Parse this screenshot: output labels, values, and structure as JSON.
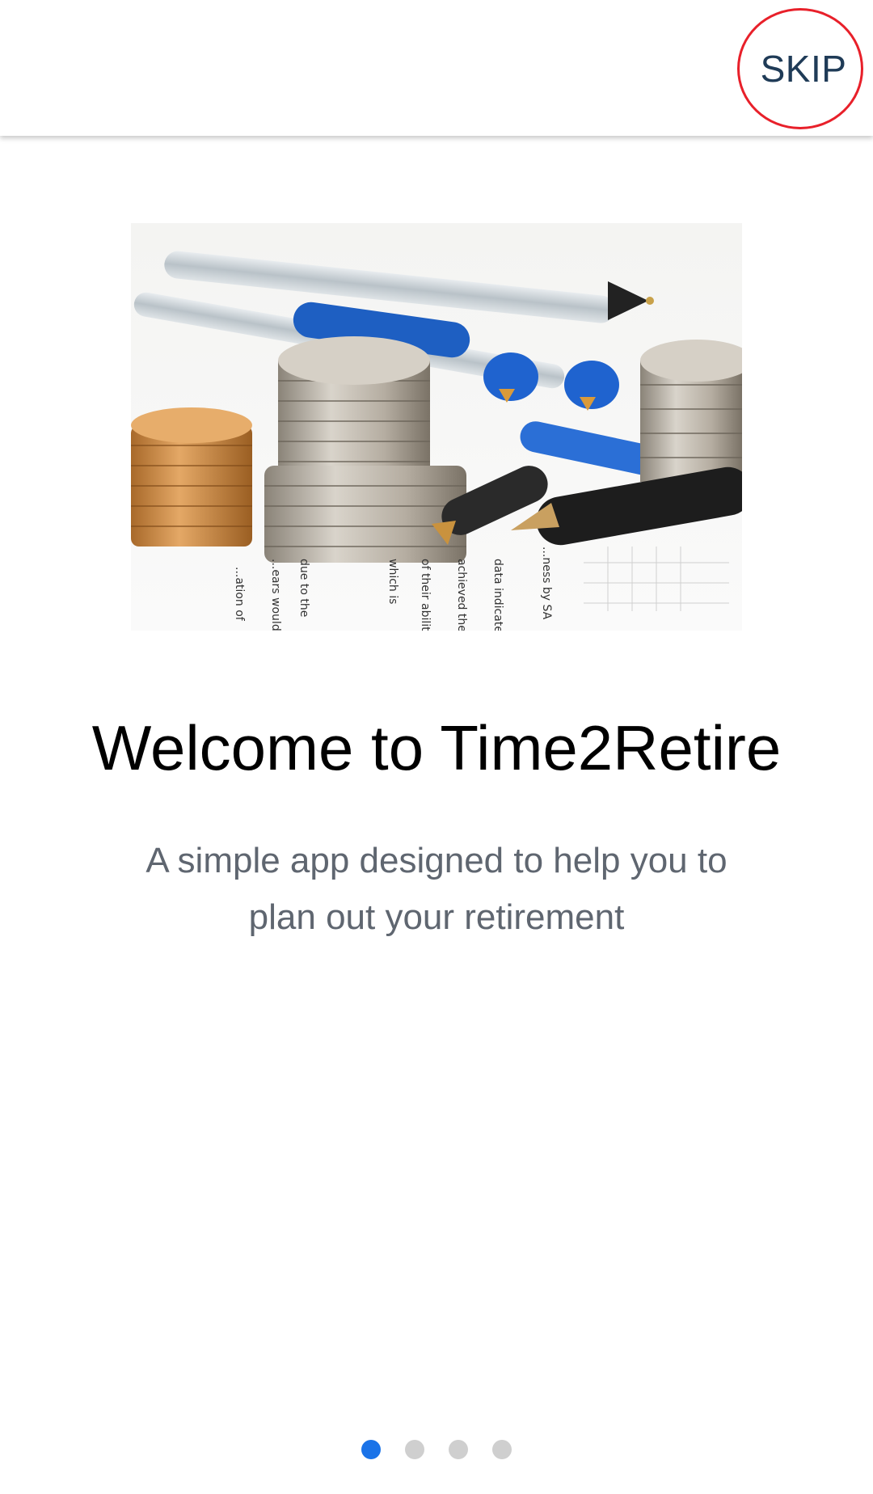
{
  "header": {
    "skip_label": "SKIP"
  },
  "onboarding": {
    "image_alt": "coins and pens on financial documents",
    "title": "Welcome to Time2Retire",
    "subtitle": "A simple app designed to help you to plan out your retirement"
  },
  "pager": {
    "pages": 4,
    "current": 1
  },
  "colors": {
    "accent": "#1a73e8",
    "skip_text": "#1f3b57",
    "highlight_ring": "#e8202a",
    "inactive_dot": "#cfcfcf",
    "subtitle_text": "#5f6670"
  }
}
